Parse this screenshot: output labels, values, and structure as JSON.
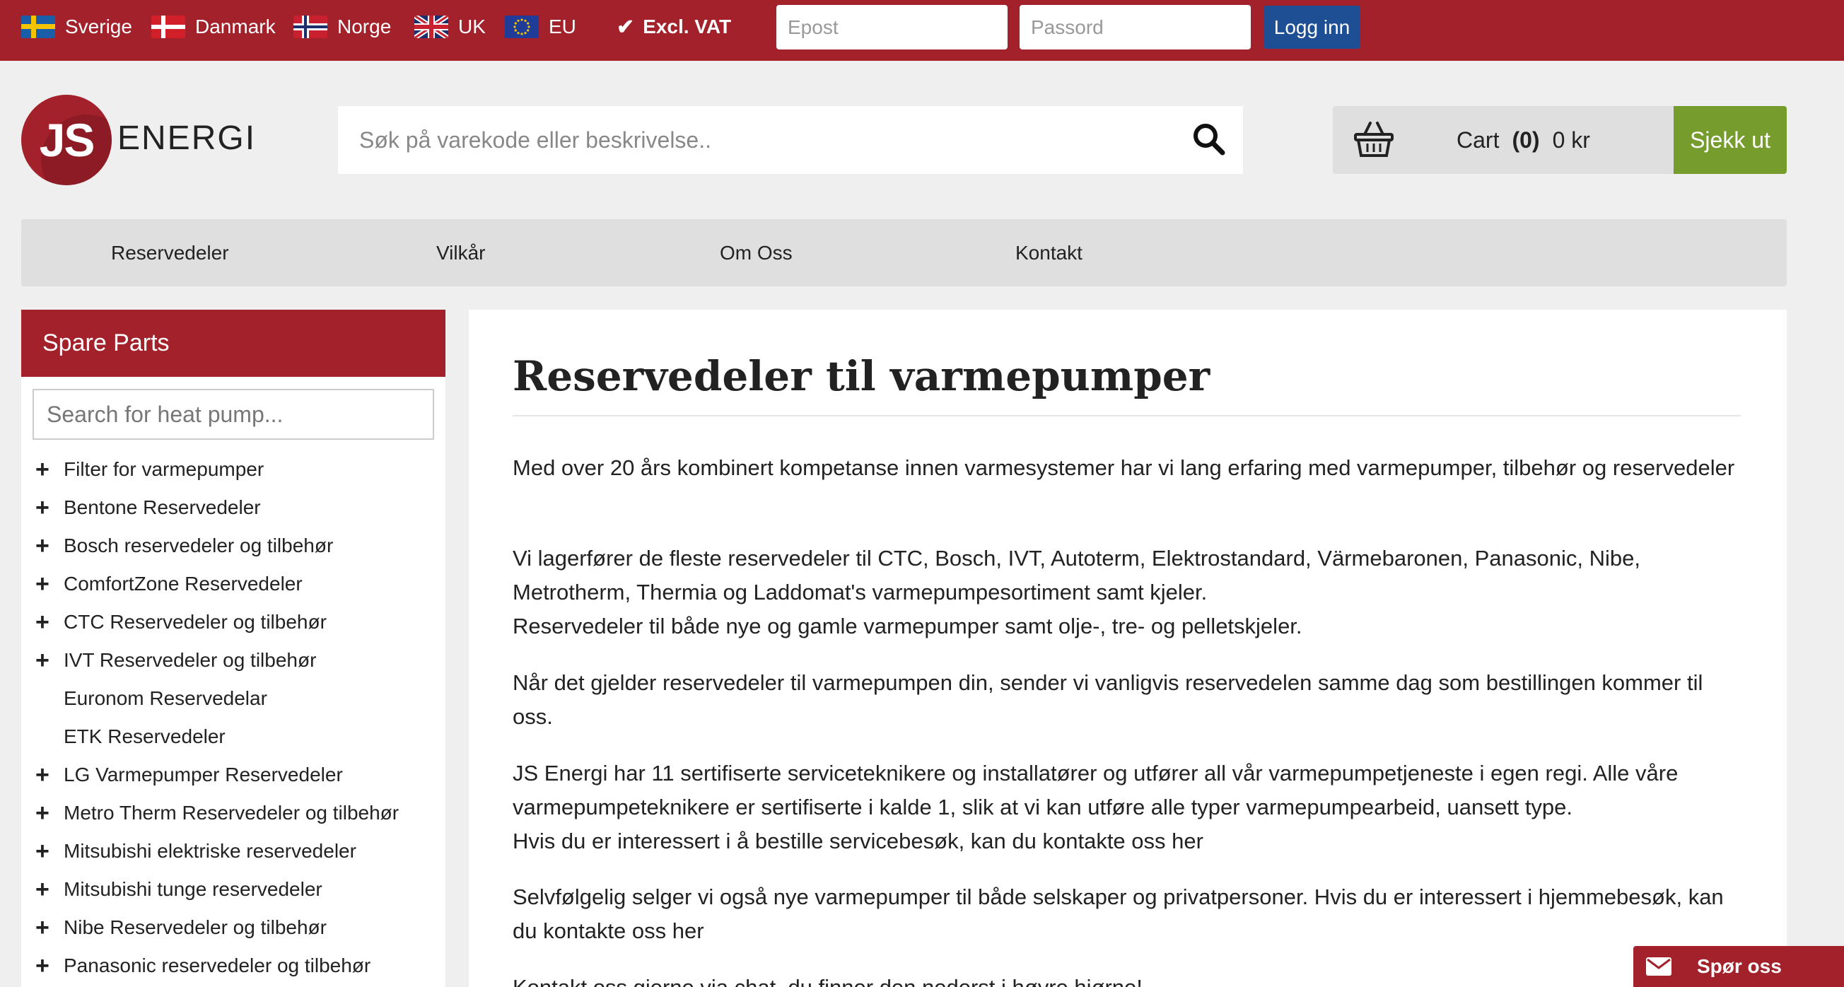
{
  "topbar": {
    "languages": [
      {
        "label": "Sverige",
        "flag": "sweden-flag-icon"
      },
      {
        "label": "Danmark",
        "flag": "denmark-flag-icon"
      },
      {
        "label": "Norge",
        "flag": "norway-flag-icon"
      },
      {
        "label": "UK",
        "flag": "uk-flag-icon"
      },
      {
        "label": "EU",
        "flag": "eu-flag-icon"
      }
    ],
    "vat_label": "Excl. VAT",
    "email_placeholder": "Epost",
    "password_placeholder": "Passord",
    "login_label": "Logg inn"
  },
  "header": {
    "logo_js": "JS",
    "logo_text": "ENERGI",
    "search_placeholder": "Søk på varekode eller beskrivelse..",
    "cart_label": "Cart",
    "cart_count": "(0)",
    "cart_total": "0 kr",
    "checkout_label": "Sjekk ut"
  },
  "nav": {
    "items": [
      "Reservedeler",
      "Vilkår",
      "Om Oss",
      "Kontakt"
    ]
  },
  "sidebar": {
    "title": "Spare Parts",
    "search_placeholder": "Search for heat pump...",
    "categories": [
      {
        "label": "Filter for varmepumper",
        "expandable": true
      },
      {
        "label": "Bentone Reservedeler",
        "expandable": true
      },
      {
        "label": "Bosch reservedeler og tilbehør",
        "expandable": true
      },
      {
        "label": "ComfortZone Reservedeler",
        "expandable": true
      },
      {
        "label": "CTC Reservedeler og tilbehør",
        "expandable": true
      },
      {
        "label": "IVT Reservedeler og tilbehør",
        "expandable": true
      },
      {
        "label": "Euronom Reservedelar",
        "expandable": false
      },
      {
        "label": "ETK Reservedeler",
        "expandable": false
      },
      {
        "label": "LG Varmepumper Reservedeler",
        "expandable": true
      },
      {
        "label": "Metro Therm Reservedeler og tilbehør",
        "expandable": true
      },
      {
        "label": "Mitsubishi elektriske reservedeler",
        "expandable": true
      },
      {
        "label": "Mitsubishi tunge reservedeler",
        "expandable": true
      },
      {
        "label": "Nibe Reservedeler og tilbehør",
        "expandable": true
      },
      {
        "label": "Panasonic reservedeler og tilbehør",
        "expandable": true
      }
    ]
  },
  "main": {
    "title": "Reservedeler til varmepumper",
    "paragraphs": [
      "Med over 20 års kombinert kompetanse innen varmesystemer har vi lang erfaring med varmepumper, tilbehør og reservedeler",
      "Vi lagerfører de fleste reservedeler til CTC, Bosch, IVT, Autoterm, Elektrostandard, Värmebaronen, Panasonic, Nibe, Metrotherm, Thermia og Laddomat's varmepumpesortiment samt kjeler.",
      "Reservedeler til både nye og gamle varmepumper samt olje-, tre- og pelletskjeler.",
      "Når det gjelder reservedeler til varmepumpen din, sender vi vanligvis reservedelen samme dag som bestillingen kommer til oss.",
      "JS Energi har 11 sertifiserte serviceteknikere og installatører og utfører all vår varmepumpetjeneste i egen regi. Alle våre varmepumpeteknikere er sertifiserte i kalde 1, slik at vi kan utføre alle typer varmepumpearbeid, uansett type.",
      "Hvis du er interessert i å bestille servicebesøk, kan du kontakte oss her",
      "Selvfølgelig selger vi også nye varmepumper til både selskaper og privatpersoner. Hvis du er interessert i hjemmebesøk, kan du kontakte oss her",
      "Kontakt oss gjerne via chat, du finner den nederst i høyre hjørne!"
    ]
  },
  "chat": {
    "label": "Spør oss"
  },
  "colors": {
    "brand_red": "#a3212a",
    "login_blue": "#1e4f94",
    "checkout_green": "#759c2c"
  }
}
